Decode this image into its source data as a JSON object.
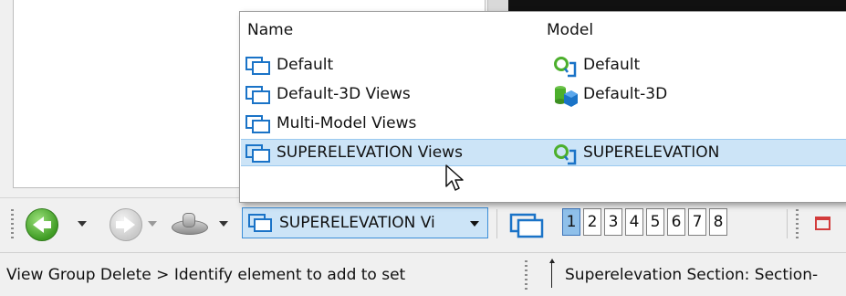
{
  "popup": {
    "headers": {
      "name": "Name",
      "model": "Model"
    },
    "rows": [
      {
        "name": "Default",
        "model": "Default",
        "model_icon": "model-2d-icon"
      },
      {
        "name": "Default-3D Views",
        "model": "Default-3D",
        "model_icon": "model-3d-icon"
      },
      {
        "name": "Multi-Model Views",
        "model": "",
        "model_icon": ""
      },
      {
        "name": "SUPERELEVATION Views",
        "model": "SUPERELEVATION",
        "model_icon": "model-2d-icon",
        "selected": true
      }
    ]
  },
  "toolbar": {
    "view_group_value": "SUPERELEVATION Vi",
    "view_numbers": [
      "1",
      "2",
      "3",
      "4",
      "5",
      "6",
      "7",
      "8"
    ],
    "active_view": "1"
  },
  "status": {
    "prompt": "View Group Delete > Identify element to add to set",
    "message": "Superelevation Section: Section-"
  },
  "colors": {
    "selection": "#cce4f7",
    "accent": "#3b8ed8",
    "icon_blue": "#1a73c7",
    "model_green": "#4caf2c"
  }
}
